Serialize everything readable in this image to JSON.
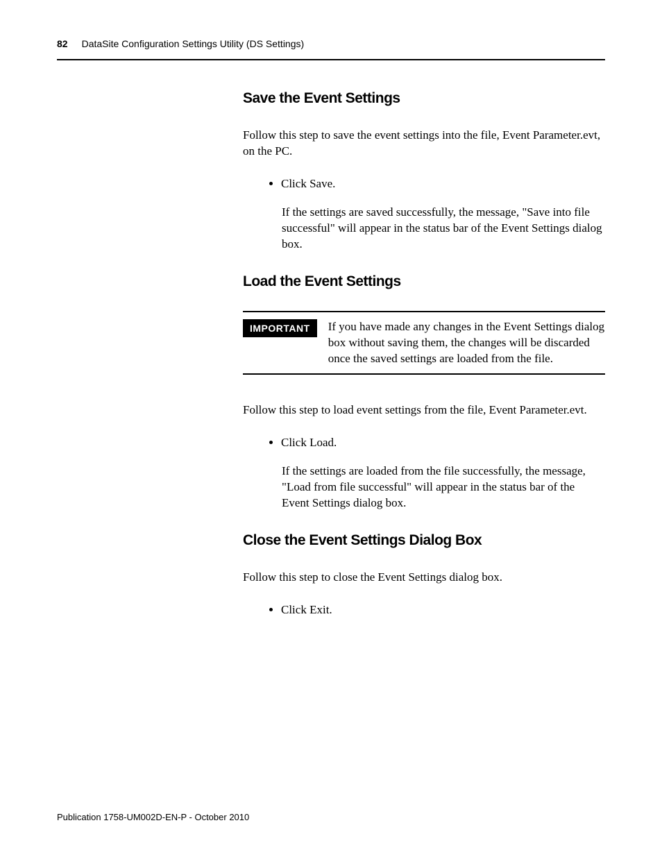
{
  "header": {
    "page_number": "82",
    "running_head": "DataSite Configuration Settings Utility (DS Settings)"
  },
  "sections": {
    "save": {
      "heading": "Save the Event Settings",
      "intro": "Follow this step to save the event settings into the file, Event Parameter.evt, on the PC.",
      "bullet": "Click Save.",
      "result": "If the settings are saved successfully, the message, \"Save into file successful\" will appear in the status bar of the Event Settings dialog box."
    },
    "load": {
      "heading": "Load the Event Settings",
      "callout_tag": "IMPORTANT",
      "callout_text": "If you have made any changes in the Event Settings dialog box without saving them, the changes will be discarded once the saved settings are loaded from the file.",
      "intro": "Follow this step to load event settings from the file, Event Parameter.evt.",
      "bullet": "Click Load.",
      "result": "If the settings are loaded from the file successfully, the message, \"Load from file successful\" will appear in the status bar of the Event Settings dialog box."
    },
    "close": {
      "heading": "Close the Event Settings Dialog Box",
      "intro": "Follow this step to close the Event Settings dialog box.",
      "bullet": "Click Exit."
    }
  },
  "footer": {
    "pubref": "Publication 1758-UM002D-EN-P - October 2010"
  }
}
